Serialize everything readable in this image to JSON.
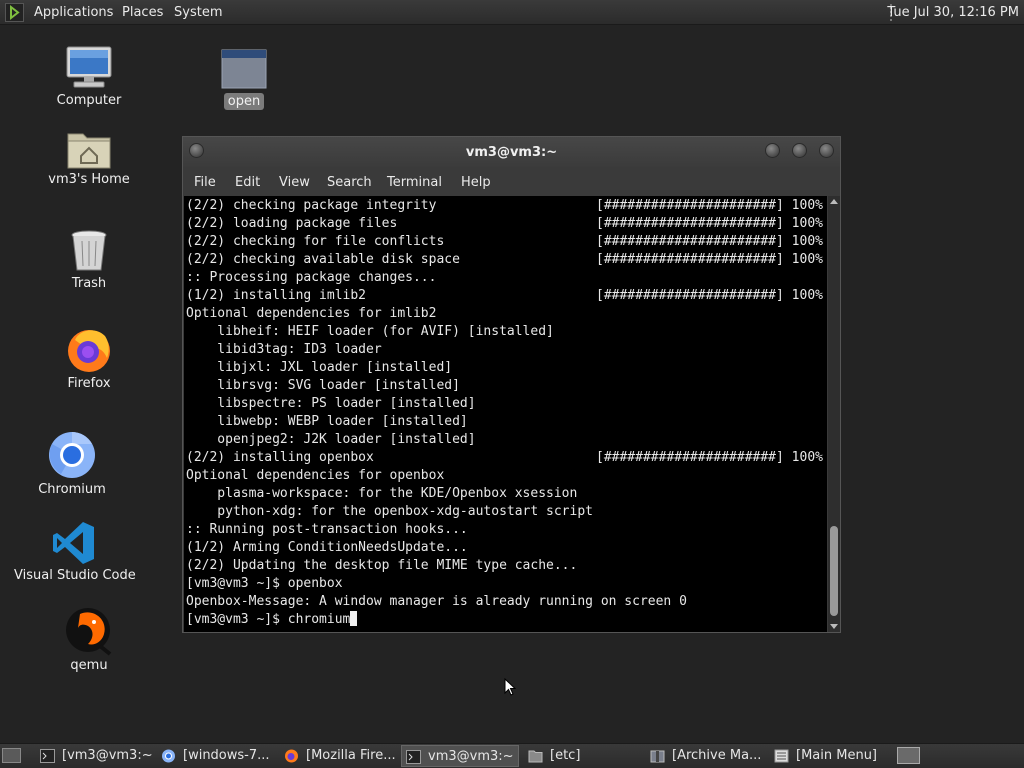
{
  "top_panel": {
    "menus": [
      "Applications",
      "Places",
      "System"
    ],
    "clock": "Tue Jul 30, 12:16 PM"
  },
  "desktop": {
    "icons": [
      {
        "label": "Computer",
        "icon": "computer-icon"
      },
      {
        "label": "open",
        "icon": "window-icon"
      },
      {
        "label": "vm3's Home",
        "icon": "home-folder-icon"
      },
      {
        "label": "Trash",
        "icon": "trash-icon"
      },
      {
        "label": "Firefox",
        "icon": "firefox-icon"
      },
      {
        "label": "Chromium",
        "icon": "chromium-icon"
      },
      {
        "label": "Visual Studio Code",
        "icon": "vscode-icon"
      },
      {
        "label": "qemu",
        "icon": "qemu-icon"
      }
    ]
  },
  "terminal": {
    "title": "vm3@vm3:~",
    "menus": [
      "File",
      "Edit",
      "View",
      "Search",
      "Terminal",
      "Help"
    ],
    "lines": [
      {
        "text": "(2/2) checking package integrity",
        "bar": "[######################] 100%"
      },
      {
        "text": "(2/2) loading package files",
        "bar": "[######################] 100%"
      },
      {
        "text": "(2/2) checking for file conflicts",
        "bar": "[######################] 100%"
      },
      {
        "text": "(2/2) checking available disk space",
        "bar": "[######################] 100%"
      },
      {
        "text": ":: Processing package changes...",
        "bar": ""
      },
      {
        "text": "(1/2) installing imlib2",
        "bar": "[######################] 100%"
      },
      {
        "text": "Optional dependencies for imlib2",
        "bar": ""
      },
      {
        "text": "    libheif: HEIF loader (for AVIF) [installed]",
        "bar": ""
      },
      {
        "text": "    libid3tag: ID3 loader",
        "bar": ""
      },
      {
        "text": "    libjxl: JXL loader [installed]",
        "bar": ""
      },
      {
        "text": "    librsvg: SVG loader [installed]",
        "bar": ""
      },
      {
        "text": "    libspectre: PS loader [installed]",
        "bar": ""
      },
      {
        "text": "    libwebp: WEBP loader [installed]",
        "bar": ""
      },
      {
        "text": "    openjpeg2: J2K loader [installed]",
        "bar": ""
      },
      {
        "text": "(2/2) installing openbox",
        "bar": "[######################] 100%"
      },
      {
        "text": "Optional dependencies for openbox",
        "bar": ""
      },
      {
        "text": "    plasma-workspace: for the KDE/Openbox xsession",
        "bar": ""
      },
      {
        "text": "    python-xdg: for the openbox-xdg-autostart script",
        "bar": ""
      },
      {
        "text": ":: Running post-transaction hooks...",
        "bar": ""
      },
      {
        "text": "(1/2) Arming ConditionNeedsUpdate...",
        "bar": ""
      },
      {
        "text": "(2/2) Updating the desktop file MIME type cache...",
        "bar": ""
      },
      {
        "text": "[vm3@vm3 ~]$ openbox",
        "bar": ""
      },
      {
        "text": "Openbox-Message: A window manager is already running on screen 0",
        "bar": ""
      },
      {
        "text": "[vm3@vm3 ~]$ chromium",
        "bar": ""
      }
    ]
  },
  "taskbar": {
    "tasks": [
      {
        "label": "[vm3@vm3:~]",
        "icon": "terminal-icon",
        "active": false
      },
      {
        "label": "[windows-7...",
        "icon": "chromium-icon",
        "active": false
      },
      {
        "label": "[Mozilla Fire...",
        "icon": "firefox-icon",
        "active": false
      },
      {
        "label": "vm3@vm3:~",
        "icon": "terminal-icon",
        "active": true
      },
      {
        "label": "[etc]",
        "icon": "folder-icon",
        "active": false
      },
      {
        "label": "[Archive Ma...",
        "icon": "archive-icon",
        "active": false
      },
      {
        "label": "[Main Menu]",
        "icon": "menu-editor-icon",
        "active": false
      }
    ]
  }
}
